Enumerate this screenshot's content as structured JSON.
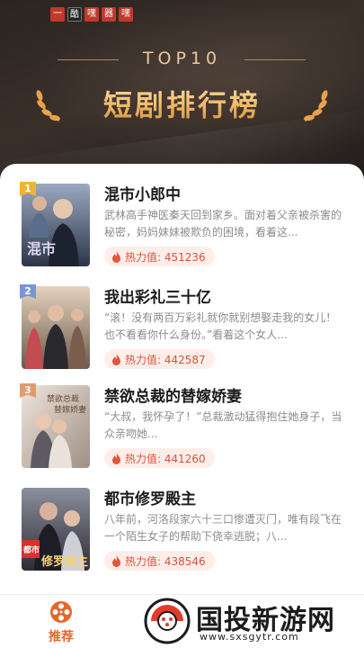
{
  "header": {
    "top_label": "TOP10",
    "title": "短剧排行榜",
    "brand_chars": [
      "一",
      "酷",
      "嘿",
      "器",
      "嘿"
    ]
  },
  "items": [
    {
      "rank": "1",
      "rank_color": "#f2b233",
      "title": "混市小郎中",
      "desc": "武林高手神医秦天回到家乡。面对着父亲被杀害的秘密，妈妈妹妹被欺负的困境，看着这...",
      "hot_label": "热力值: 451236",
      "poster_caption": "混市小郎中",
      "poster_colors": [
        "#3d4c63",
        "#9aa9c0"
      ]
    },
    {
      "rank": "2",
      "rank_color": "#7a95d6",
      "title": "我出彩礼三十亿",
      "desc": "“滚！没有两百万彩礼就你就别想娶走我的女儿！也不看看你什么身份。”看着这个女人...",
      "hot_label": "热力值: 442587",
      "poster_caption": "",
      "poster_colors": [
        "#6b5a4b",
        "#d8c7b4"
      ]
    },
    {
      "rank": "3",
      "rank_color": "#e39a6f",
      "title": "禁欲总裁的替嫁娇妻",
      "desc": "“大叔，我怀孕了！”总裁激动猛得抱住她身子，当众亲吻她...",
      "hot_label": "热力值: 441260",
      "poster_caption": "禁欲总裁的替嫁娇妻",
      "poster_colors": [
        "#b9a89c",
        "#efe5dc"
      ]
    },
    {
      "rank": "",
      "rank_color": "",
      "title": "都市修罗殿主",
      "desc": "八年前，河洛段家六十三口惨遭灭门，唯有段飞在一个陌生女子的帮助下侥幸逃脱；八...",
      "hot_label": "热力值: 438546",
      "poster_caption": "都市 修罗殿主",
      "poster_colors": [
        "#3c3a45",
        "#8b8f9c"
      ]
    }
  ],
  "bottom_nav": {
    "tab_label": "推荐",
    "tab_icon": "film-reel-icon",
    "accent": "#e6672a"
  },
  "watermark": {
    "text": "国投新游网",
    "url": "www.sxsgytr.com"
  }
}
